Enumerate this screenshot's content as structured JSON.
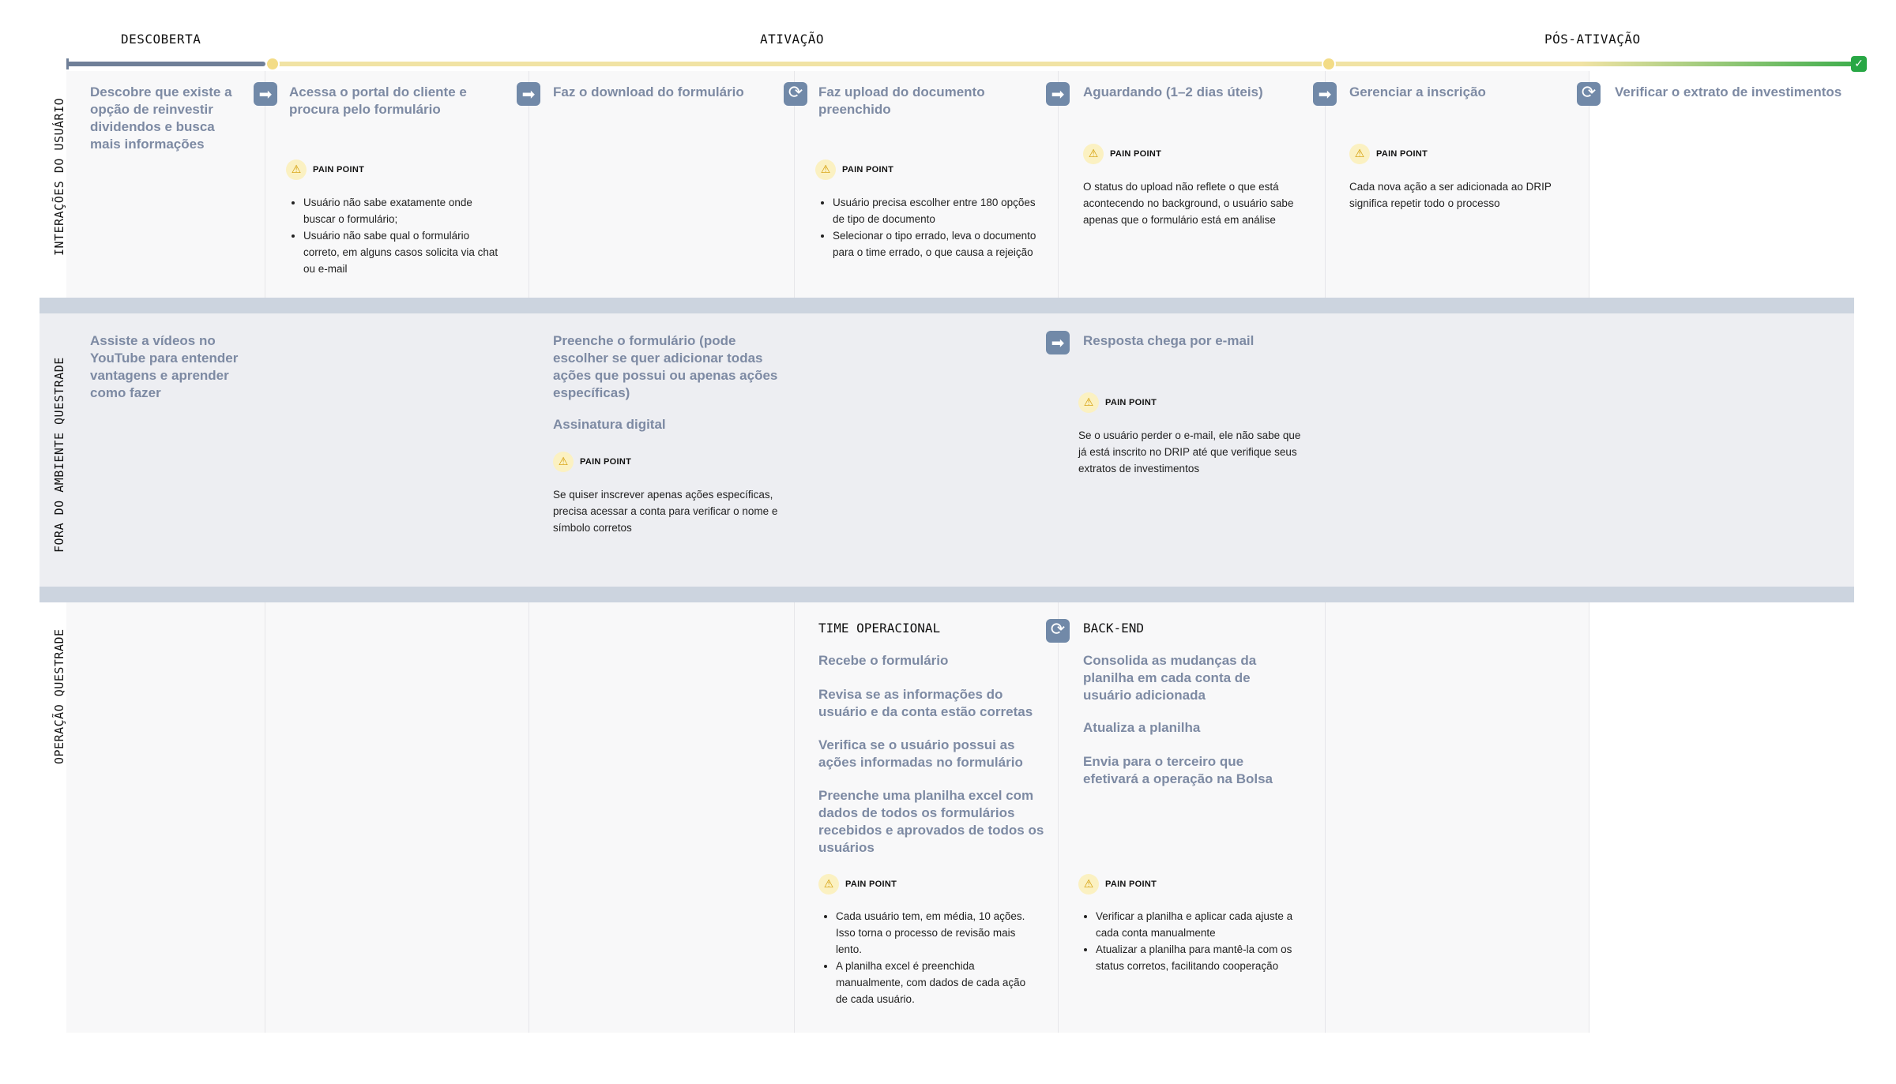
{
  "phases": {
    "descoberta": "DESCOBERTA",
    "ativacao": "ATIVAÇÃO",
    "pos_ativacao": "PÓS-ATIVAÇÃO"
  },
  "lanes": {
    "usuario": "INTERAÇÕES DO USUÁRIO",
    "fora": "FORA DO AMBIENTE QUESTRADE",
    "operacao": "OPERAÇÃO QUESTRADE"
  },
  "pain_label": "PAIN POINT",
  "icons": {
    "arrow": "➡",
    "sync": "⟳",
    "warning": "⚠",
    "check": "✓"
  },
  "colors": {
    "step_text": "#7d8aa3",
    "icon_bg": "#7189a8",
    "progress_start": "#6f7f98",
    "progress_mid": "#f1e3a4",
    "progress_end": "#3fae4d",
    "separator": "#ccd4df"
  },
  "user_row": {
    "s1": "Descobre que existe a opção de reinvestir dividendos e busca mais informações",
    "s2": "Acessa o portal do cliente e procura pelo formulário",
    "s2_pain": [
      "Usuário não sabe exatamente onde buscar o formulário;",
      "Usuário não sabe qual o formulário correto, em alguns casos solicita via chat ou e-mail"
    ],
    "s3": "Faz o download do formulário",
    "s4": "Faz upload do documento preenchido",
    "s4_pain": [
      "Usuário precisa escolher entre 180 opções de tipo de documento",
      "Selecionar o tipo errado, leva o documento para o time errado, o que causa a rejeição"
    ],
    "s5": "Aguardando (1–2 dias úteis)",
    "s5_pain": "O status do upload não reflete o que está acontecendo no background, o usuário sabe apenas que o formulário está em análise",
    "s6": "Gerenciar a inscrição",
    "s6_pain": "Cada nova ação a ser adicionada ao DRIP significa repetir todo o processo",
    "s7": "Verificar o extrato de investimentos"
  },
  "outside_row": {
    "a1": "Assiste a vídeos no YouTube para entender vantagens e aprender como fazer",
    "a3": "Preenche o formulário (pode escolher se quer adicionar todas ações que possui ou apenas ações específicas)",
    "a3b": "Assinatura digital",
    "a3_pain": "Se quiser inscrever apenas ações específicas, precisa acessar a conta para verificar o nome e símbolo corretos",
    "a5": "Resposta chega por e-mail",
    "a5_pain": "Se o usuário perder o e-mail, ele não sabe que já está inscrito no DRIP até que verifique seus extratos de investimentos"
  },
  "ops_row": {
    "team1_title": "TIME OPERACIONAL",
    "team1_steps": [
      "Recebe o formulário",
      "Revisa se as informações do usuário e da conta estão corretas",
      "Verifica se o usuário possui as ações informadas no formulário",
      "Preenche uma planilha excel com dados de todos os formulários recebidos e aprovados de todos os usuários"
    ],
    "team1_pain": [
      "Cada usuário tem, em média, 10 ações. Isso torna o processo de revisão mais lento.",
      "A planilha excel é preenchida manualmente, com dados de cada ação de cada usuário."
    ],
    "team2_title": "BACK-END",
    "team2_steps": [
      "Consolida as mudanças da planilha em cada conta de usuário adicionada",
      "Atualiza a planilha",
      "Envia para o terceiro que efetivará a operação na Bolsa"
    ],
    "team2_pain": [
      "Verificar a planilha e aplicar cada ajuste a cada conta manualmente",
      "Atualizar a planilha para mantê-la com os status corretos, facilitando cooperação"
    ]
  }
}
